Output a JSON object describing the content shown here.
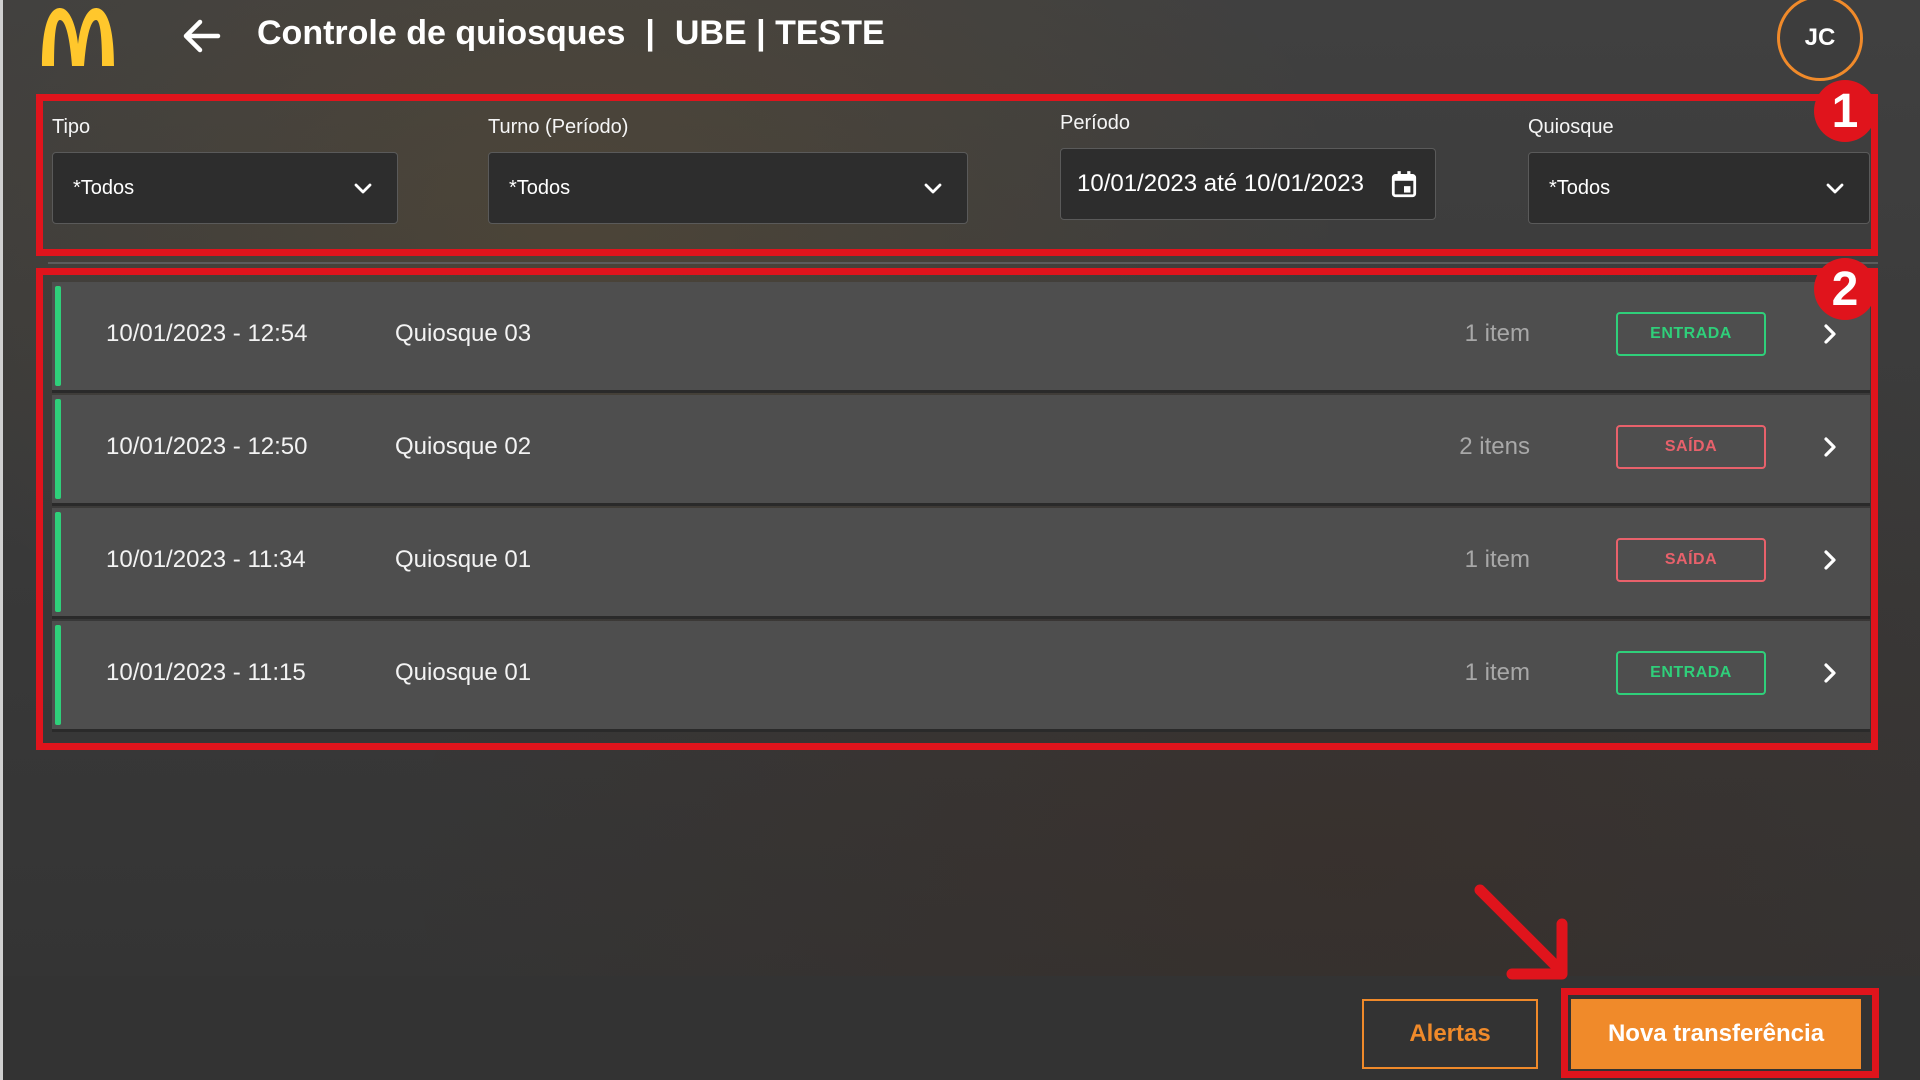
{
  "header": {
    "title": "Controle de quiosques",
    "separator": "|",
    "store": "UBE | TESTE",
    "avatar_initials": "JC"
  },
  "filters": {
    "tipo": {
      "label": "Tipo",
      "value": "*Todos"
    },
    "turno": {
      "label": "Turno (Período)",
      "value": "*Todos"
    },
    "periodo": {
      "label": "Período",
      "value": "10/01/2023 até 10/01/2023"
    },
    "quiosque": {
      "label": "Quiosque",
      "value": "*Todos"
    }
  },
  "rows": [
    {
      "datetime": "10/01/2023 - 12:54",
      "kiosk": "Quiosque 03",
      "count": "1 item",
      "type": "ENTRADA"
    },
    {
      "datetime": "10/01/2023 - 12:50",
      "kiosk": "Quiosque 02",
      "count": "2 itens",
      "type": "SAÍDA"
    },
    {
      "datetime": "10/01/2023 - 11:34",
      "kiosk": "Quiosque 01",
      "count": "1 item",
      "type": "SAÍDA"
    },
    {
      "datetime": "10/01/2023 - 11:15",
      "kiosk": "Quiosque 01",
      "count": "1 item",
      "type": "ENTRADA"
    }
  ],
  "footer": {
    "alerts_label": "Alertas",
    "new_transfer_label": "Nova transferência"
  },
  "annotations": {
    "box1": "1",
    "box2": "2"
  },
  "colors": {
    "accent": "#f08a2a",
    "entrada": "#2fcf7a",
    "saida": "#e8616b",
    "highlight": "#e0141c",
    "logo": "#ffc72c"
  },
  "icons": [
    "mcdonalds-logo",
    "back-arrow-icon",
    "chevron-down-icon",
    "calendar-icon",
    "chevron-right-icon"
  ]
}
